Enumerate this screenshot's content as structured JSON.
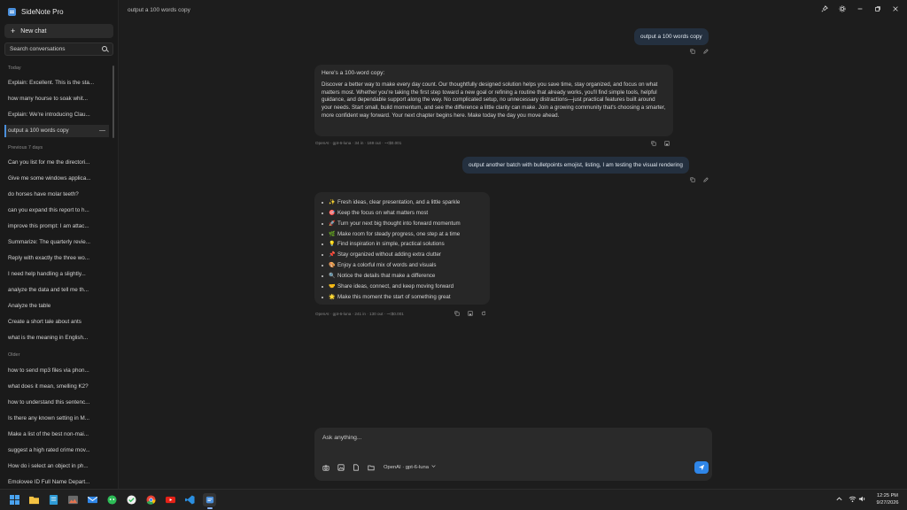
{
  "app": {
    "title": "SideNote Pro",
    "window_title": "output a 100 words copy"
  },
  "sidebar": {
    "new_chat_label": "New chat",
    "search_placeholder": "Search conversations",
    "sections": [
      {
        "label": "Today",
        "items": [
          "Explain: Excellent. This is the sta...",
          "how many hourse to soak whit...",
          "Explain: We're introducing Clau...",
          "output a 100 words copy"
        ]
      },
      {
        "label": "Previous 7 days",
        "items": [
          "Can you list for me the directori...",
          "Give me some windows applica...",
          "do horses have molar teeth?",
          "can you expand this report to h...",
          "improve this prompt: I am attac...",
          "Summarize: The quarterly revie...",
          "Reply with exactly the three wo...",
          "I need help handling a slightly...",
          "analyze the data and tell me th...",
          "Analyze the table",
          "Create a short tale about ants",
          "what is the meaning in English..."
        ]
      },
      {
        "label": "Older",
        "items": [
          "how to send mp3 files via phon...",
          "what does it mean, smelling K2?",
          "how to understand this sentenc...",
          "Is there any known setting in M...",
          "Make a list of the best non-mai...",
          "suggest a high rated crime mov...",
          "How do i select an object in ph...",
          "Emolovee ID Full Name Depart..."
        ]
      }
    ],
    "active_item_menu": "—"
  },
  "chat": {
    "messages": [
      {
        "role": "user",
        "text": "output a 100 words copy"
      },
      {
        "role": "assistant",
        "intro": "Here's a 100-word copy:",
        "body": "Discover a better way to make every day count. Our thoughtfully designed solution helps you save time, stay organized, and focus on what matters most. Whether you're taking the first step toward a new goal or refining a routine that already works, you'll find simple tools, helpful guidance, and dependable support along the way. No complicated setup, no unnecessary distractions—just practical features built around your needs. Start small, build momentum, and see the difference a little clarity can make. Join a growing community that's choosing a smarter, more confident way forward. Your next chapter begins here. Make today the day you move ahead.",
        "meta": "OpenAI · gpt-6-luna · 34 in · 169 out · ~<$0.001"
      },
      {
        "role": "user",
        "text": "output another batch with bulletpoints emojist, listing, I am testing the visual rendering"
      },
      {
        "role": "assistant",
        "bullets": [
          {
            "emoji": "✨",
            "text": "Fresh ideas, clear presentation, and a little sparkle"
          },
          {
            "emoji": "🎯",
            "text": "Keep the focus on what matters most"
          },
          {
            "emoji": "🚀",
            "text": "Turn your next big thought into forward momentum"
          },
          {
            "emoji": "🌿",
            "text": "Make room for steady progress, one step at a time"
          },
          {
            "emoji": "💡",
            "text": "Find inspiration in simple, practical solutions"
          },
          {
            "emoji": "📌",
            "text": "Stay organized without adding extra clutter"
          },
          {
            "emoji": "🎨",
            "text": "Enjoy a colorful mix of words and visuals"
          },
          {
            "emoji": "🔍",
            "text": "Notice the details that make a difference"
          },
          {
            "emoji": "🤝",
            "text": "Share ideas, connect, and keep moving forward"
          },
          {
            "emoji": "🌟",
            "text": "Make this moment the start of something great"
          }
        ],
        "meta": "OpenAI · gpt-6-luna · 241 in · 130 out · ~<$0.001"
      }
    ]
  },
  "composer": {
    "placeholder": "Ask anything...",
    "model_label": "OpenAI · gpt-6-luna"
  },
  "taskbar": {
    "time": "12:25 PM",
    "date": "9/27/2026"
  },
  "colors": {
    "accent": "#2f86e8",
    "user_bubble": "#24303f",
    "assistant_bubble": "#272727",
    "background": "#1d1d1d"
  }
}
